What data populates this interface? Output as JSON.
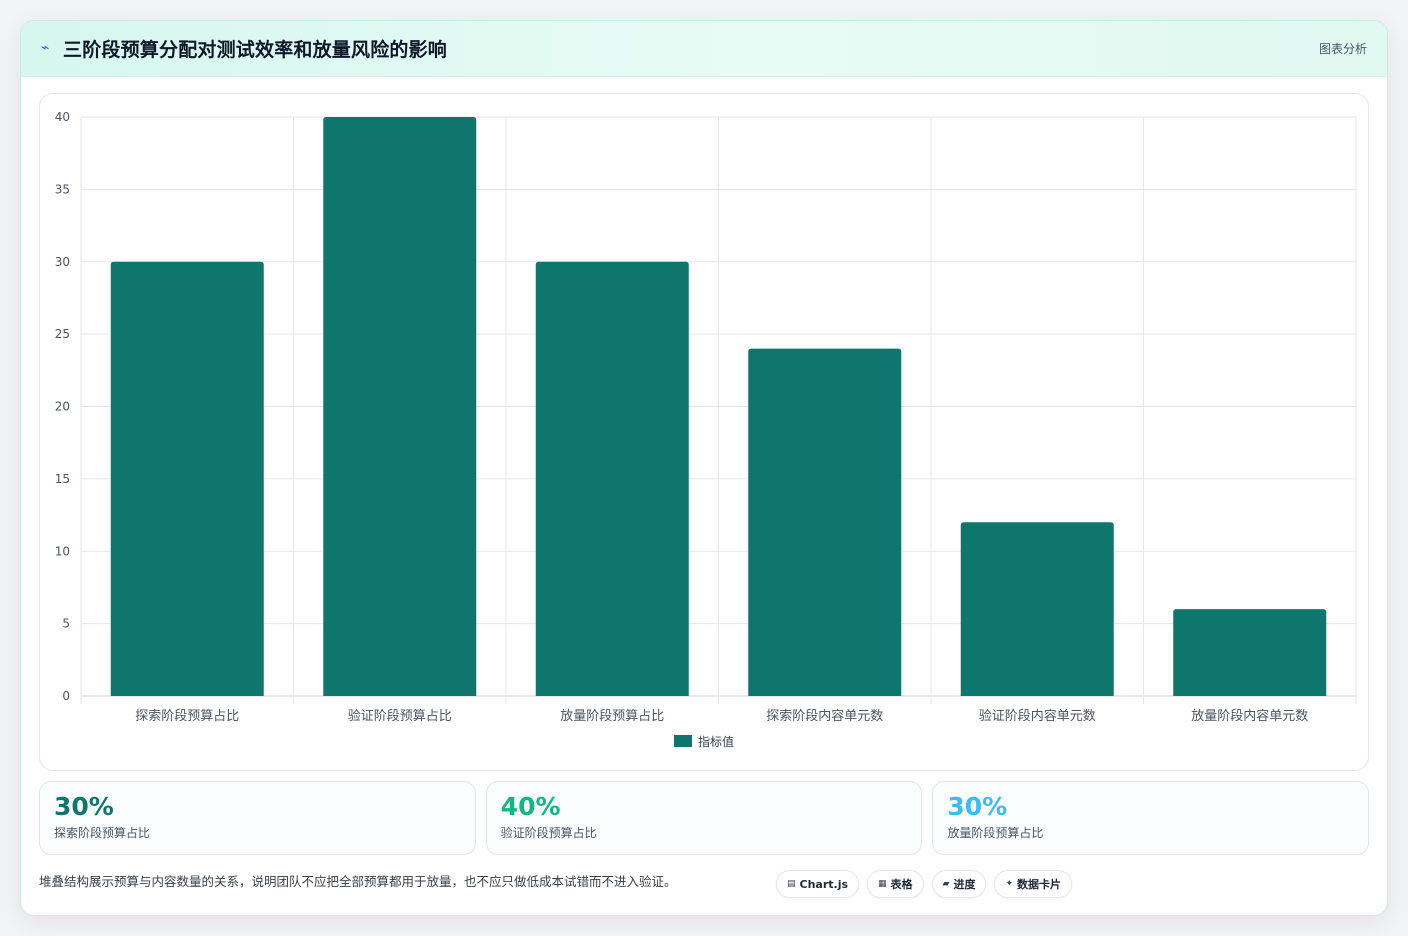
{
  "header": {
    "icon": "chart-line-icon",
    "title": "三阶段预算分配对测试效率和放量风险的影响",
    "right_label": "图表分析"
  },
  "chart_data": {
    "type": "bar",
    "categories": [
      "探索阶段预算占比",
      "验证阶段预算占比",
      "放量阶段预算占比",
      "探索阶段内容单元数",
      "验证阶段内容单元数",
      "放量阶段内容单元数"
    ],
    "series": [
      {
        "name": "指标值",
        "values": [
          30,
          40,
          30,
          24,
          12,
          6
        ],
        "color": "#0f766e"
      }
    ],
    "yticks": [
      0,
      5,
      10,
      15,
      20,
      25,
      30,
      35,
      40
    ],
    "ylim": [
      0,
      40
    ],
    "grid": true,
    "legend_position": "bottom"
  },
  "stats": [
    {
      "value": "30%",
      "label": "探索阶段预算占比",
      "color": "#0f766e"
    },
    {
      "value": "40%",
      "label": "验证阶段预算占比",
      "color": "#10b981"
    },
    {
      "value": "30%",
      "label": "放量阶段预算占比",
      "color": "#38bdf8"
    }
  ],
  "footer": {
    "note": "堆叠结构展示预算与内容数量的关系，说明团队不应把全部预算都用于放量，也不应只做低成本试错而不进入验证。",
    "chips": [
      {
        "icon": "chart-icon",
        "glyph": "▤",
        "label": "Chart.js"
      },
      {
        "icon": "table-icon",
        "glyph": "▦",
        "label": "表格"
      },
      {
        "icon": "progress-icon",
        "glyph": "▰",
        "label": "进度"
      },
      {
        "icon": "data-card-icon",
        "glyph": "✦",
        "label": "数据卡片"
      }
    ]
  }
}
